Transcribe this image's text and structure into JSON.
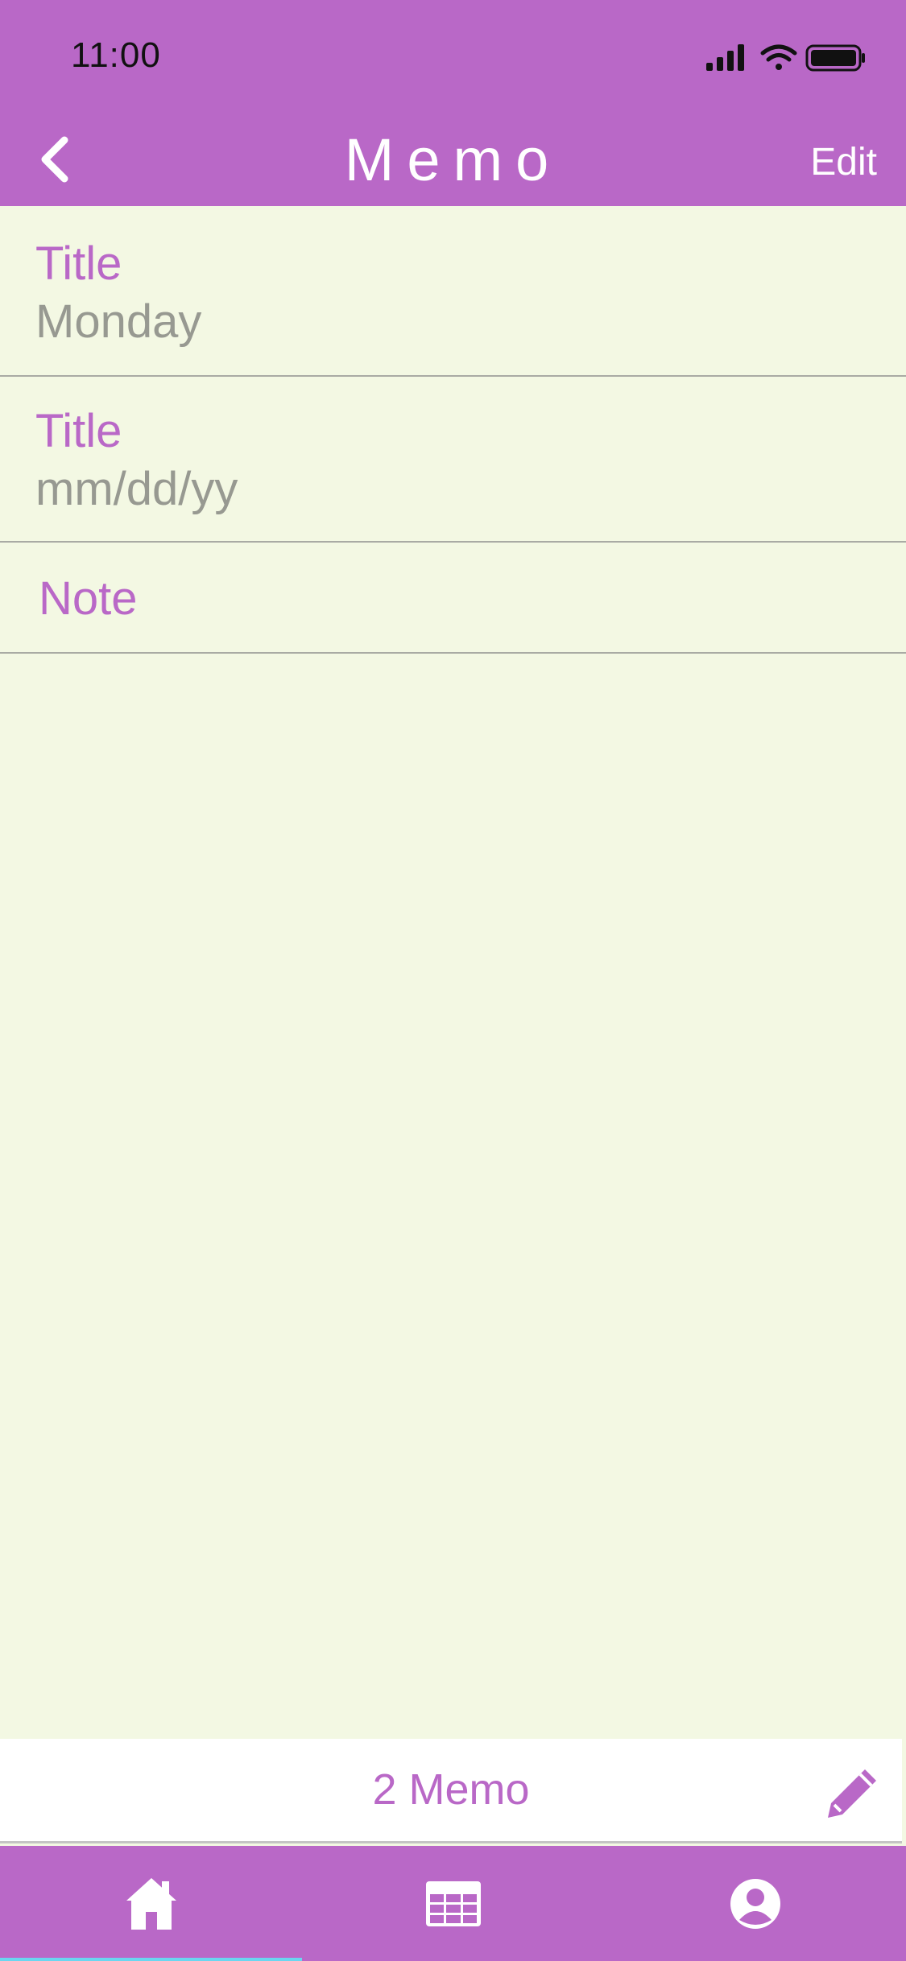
{
  "status_bar": {
    "time": "11:00"
  },
  "nav": {
    "title": "Memo",
    "edit_label": "Edit"
  },
  "fields": [
    {
      "label": "Title",
      "value": "Monday"
    },
    {
      "label": "Title",
      "value": "mm/dd/yy"
    },
    {
      "label": "Note"
    }
  ],
  "footer": {
    "counter": "2 Memo"
  },
  "tabs": [
    {
      "icon": "home-icon",
      "active": true
    },
    {
      "icon": "calendar-grid-icon",
      "active": false
    },
    {
      "icon": "user-icon",
      "active": false
    }
  ],
  "colors": {
    "accent": "#b968c7",
    "background": "#f3f8e3",
    "placeholder": "#979991",
    "active_tab_indicator": "#6ad6f0"
  }
}
